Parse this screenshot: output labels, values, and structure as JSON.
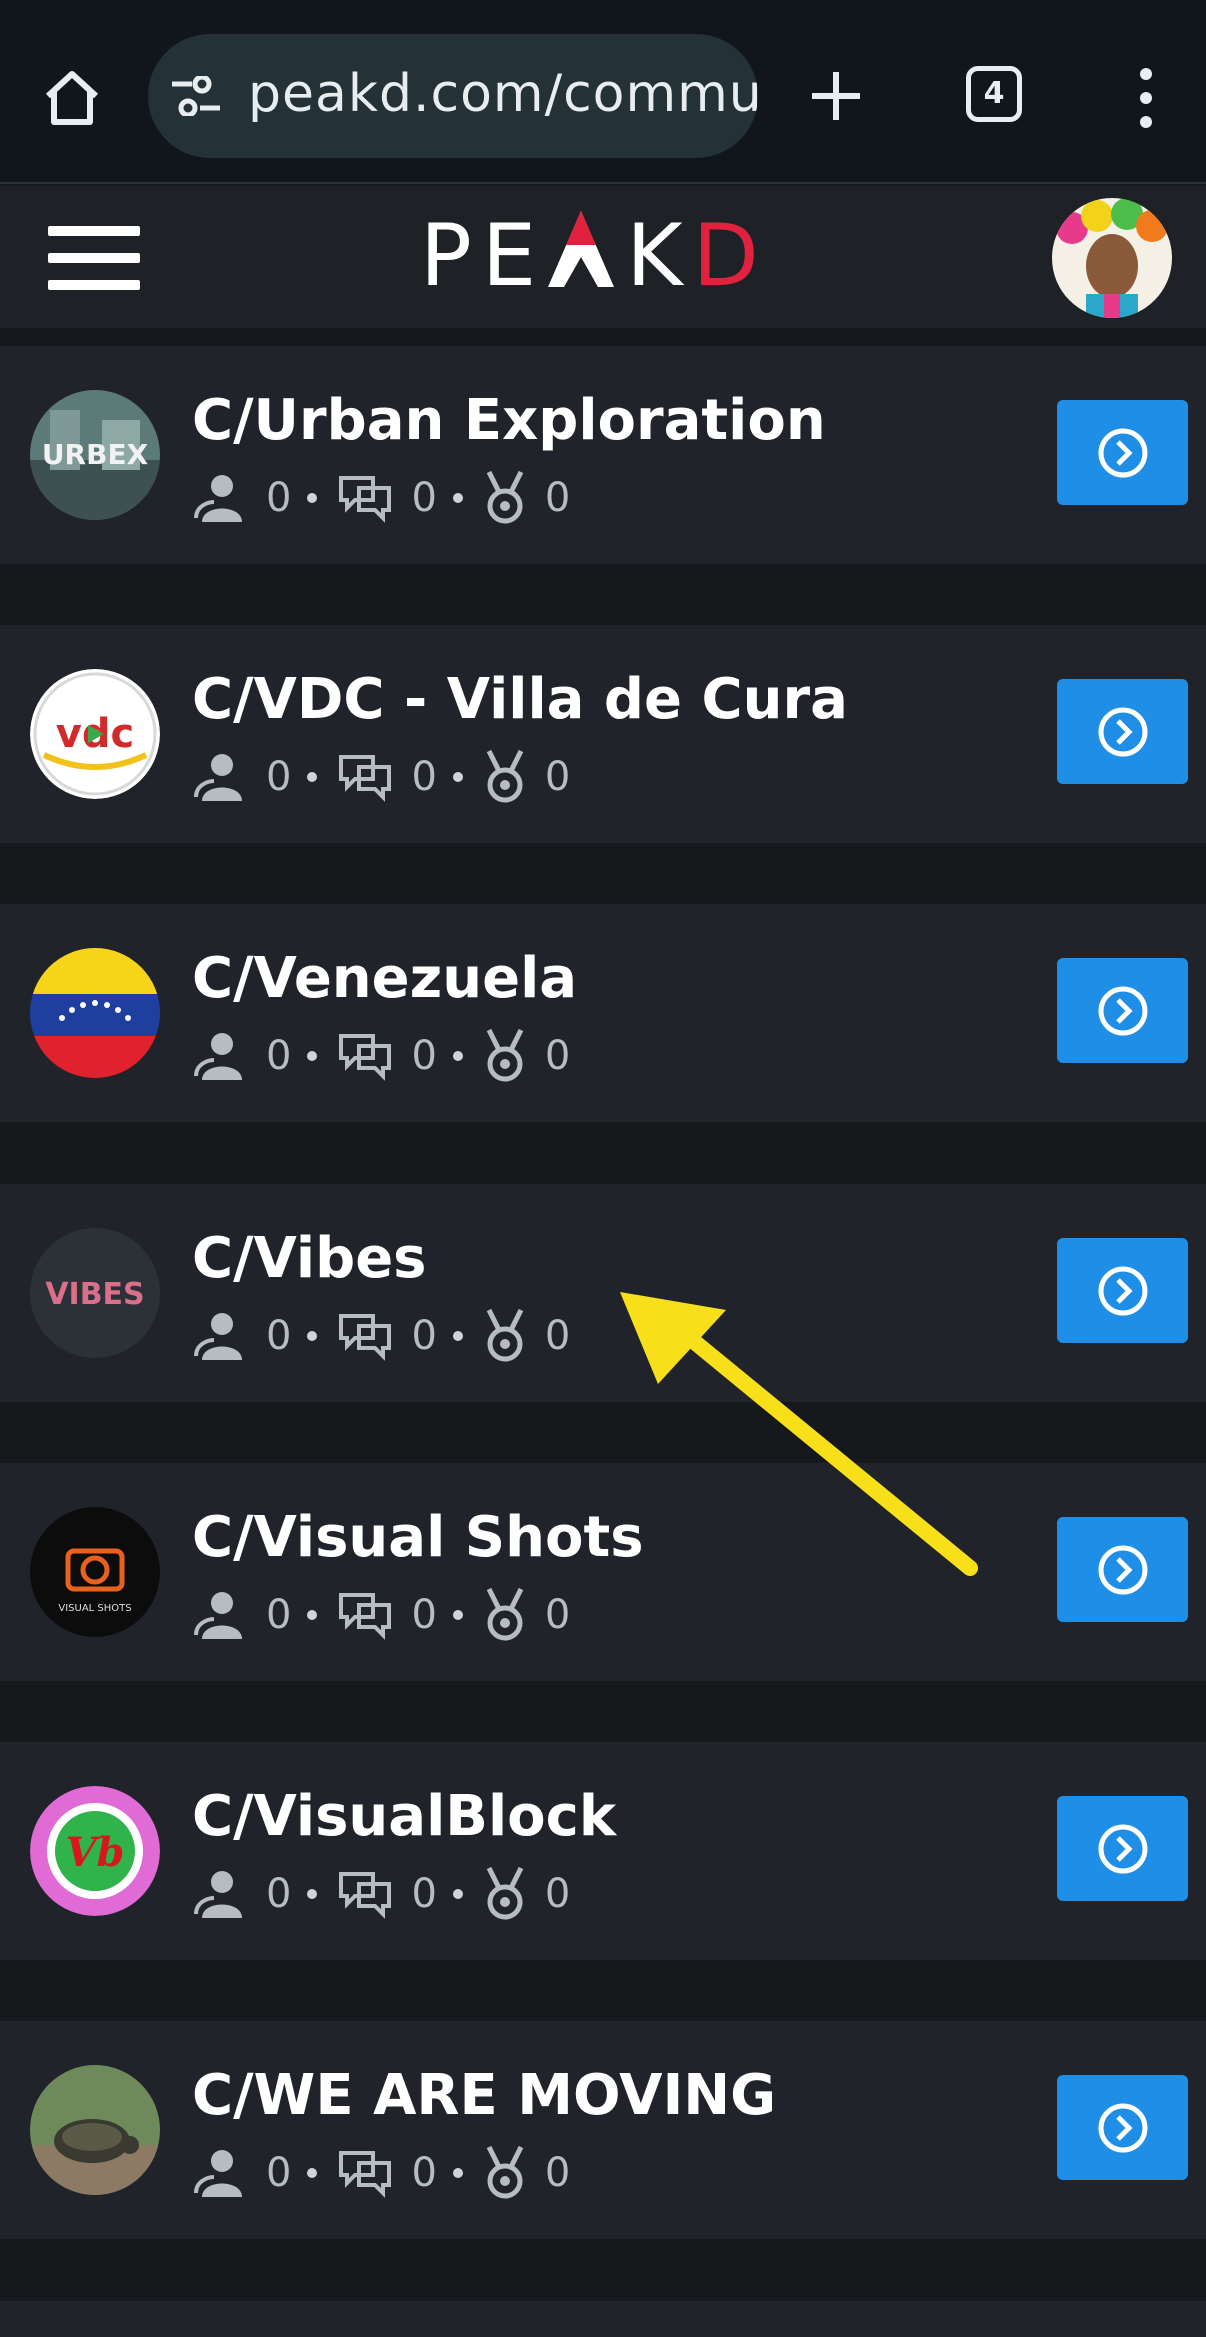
{
  "browser": {
    "url": "peakd.com/commur",
    "tab_count": "4",
    "icons": [
      "home-icon",
      "site-settings-icon",
      "new-tab-icon",
      "tab-switcher-icon",
      "more-menu-icon"
    ]
  },
  "header": {
    "logo": {
      "part1": "PE",
      "part2": "K",
      "part3": "D"
    },
    "icons": [
      "hamburger-menu-icon",
      "user-avatar"
    ]
  },
  "communities": [
    {
      "name": "C/Urban Exploration",
      "subscribers": "0",
      "posts": "0",
      "rewards": "0",
      "avatar": "urbex"
    },
    {
      "name": "C/VDC - Villa de Cura",
      "subscribers": "0",
      "posts": "0",
      "rewards": "0",
      "avatar": "vdc"
    },
    {
      "name": "C/Venezuela",
      "subscribers": "0",
      "posts": "0",
      "rewards": "0",
      "avatar": "venezuela-flag"
    },
    {
      "name": "C/Vibes",
      "subscribers": "0",
      "posts": "0",
      "rewards": "0",
      "avatar": "vibes"
    },
    {
      "name": "C/Visual Shots",
      "subscribers": "0",
      "posts": "0",
      "rewards": "0",
      "avatar": "visual-shots"
    },
    {
      "name": "C/VisualBlock",
      "subscribers": "0",
      "posts": "0",
      "rewards": "0",
      "avatar": "visualblock"
    },
    {
      "name": "C/WE ARE MOVING",
      "subscribers": "0",
      "posts": "0",
      "rewards": "0",
      "avatar": "turtle-photo"
    }
  ],
  "avatar_text": {
    "urbex": "URBEX",
    "vibes": "VIBES",
    "vdc": "vdc",
    "visual_shots": "VISUAL SHOTS",
    "visualblock": "Vb"
  },
  "colors": {
    "accent": "#1e8ee6",
    "brand_red": "#e0223f",
    "row_bg": "#20242a",
    "page_bg": "#16191c",
    "annotation_arrow": "#f7e01a"
  }
}
